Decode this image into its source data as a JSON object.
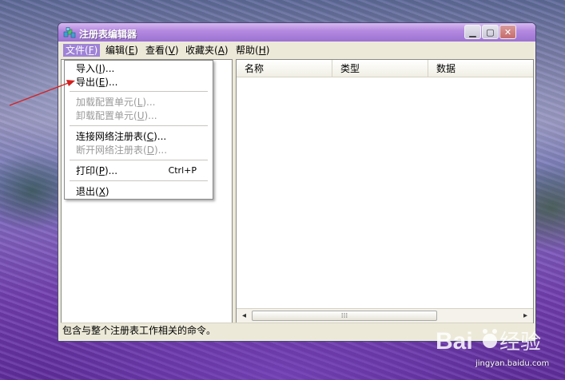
{
  "window": {
    "title": "注册表编辑器",
    "buttons": {
      "minimize": "▁",
      "maximize": "▢",
      "close": "✕"
    }
  },
  "menubar": [
    {
      "text": "文件(",
      "key": "F",
      "after": ")"
    },
    {
      "text": "编辑(",
      "key": "E",
      "after": ")"
    },
    {
      "text": "查看(",
      "key": "V",
      "after": ")"
    },
    {
      "text": "收藏夹(",
      "key": "A",
      "after": ")"
    },
    {
      "text": "帮助(",
      "key": "H",
      "after": ")"
    }
  ],
  "file_menu": {
    "import": {
      "text": "导入(",
      "key": "I",
      "after": ")..."
    },
    "export": {
      "text": "导出(",
      "key": "E",
      "after": ")..."
    },
    "load_hive": {
      "text": "加载配置单元(",
      "key": "L",
      "after": ")..."
    },
    "unload_hive": {
      "text": "卸载配置单元(",
      "key": "U",
      "after": ")..."
    },
    "connect": {
      "text": "连接网络注册表(",
      "key": "C",
      "after": ")..."
    },
    "disconnect": {
      "text": "断开网络注册表(",
      "key": "D",
      "after": ")..."
    },
    "print": {
      "text": "打印(",
      "key": "P",
      "after": ")...",
      "shortcut": "Ctrl+P"
    },
    "exit": {
      "text": "退出(",
      "key": "X",
      "after": ")"
    }
  },
  "list_headers": [
    "名称",
    "类型",
    "数据"
  ],
  "scrollbar": {
    "left": "◂",
    "right": "▸",
    "grip": "⁞⁞⁞"
  },
  "statusbar": {
    "text": "包含与整个注册表工作相关的命令。"
  },
  "watermark": {
    "logo": "Baidu经验",
    "url": "jingyan.baidu.com"
  },
  "colors": {
    "titlebar": "#b58ae0",
    "menu_highlight": "#9f83d6",
    "arrow": "#d42020"
  }
}
